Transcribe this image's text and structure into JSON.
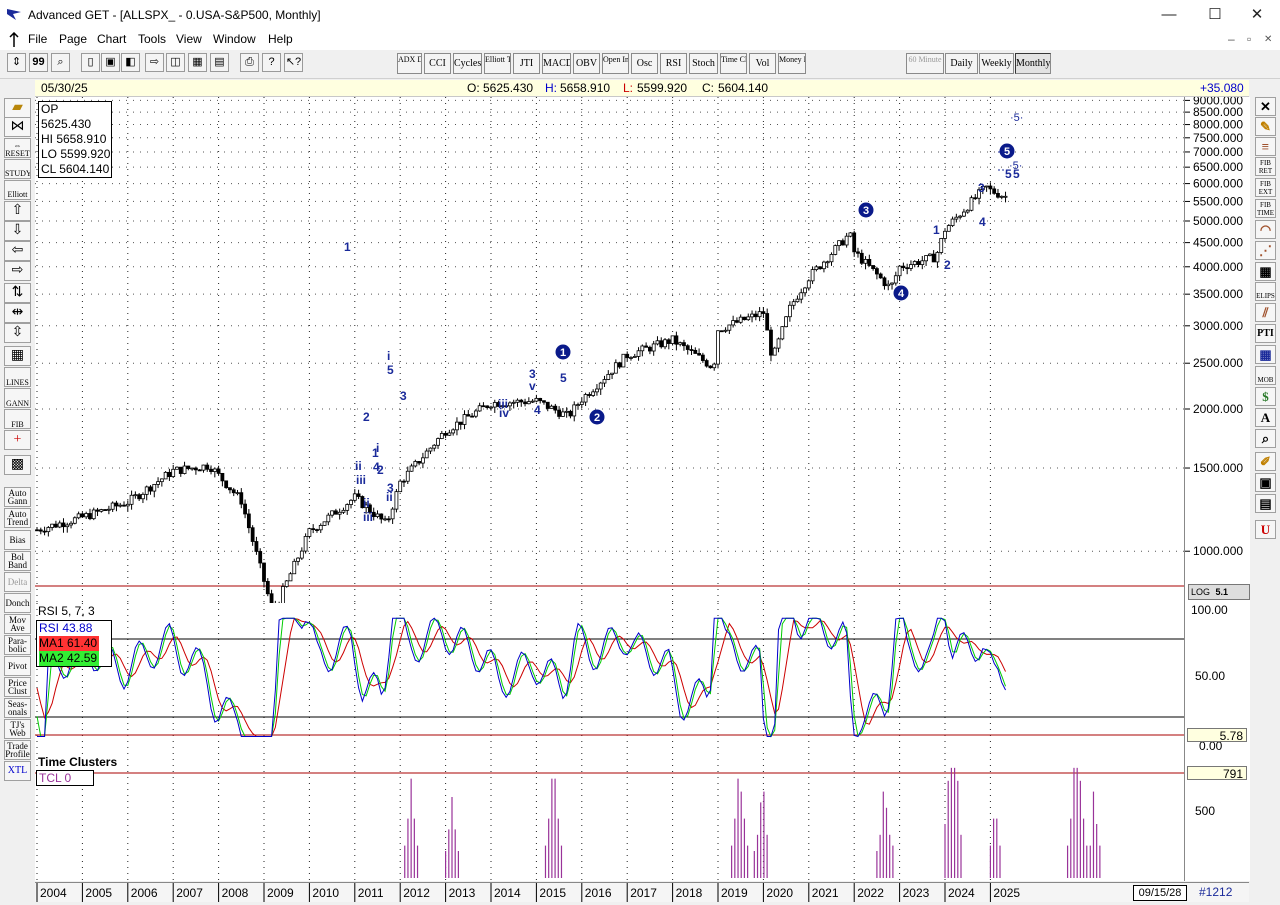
{
  "window": {
    "title": "Advanced GET - [ALLSPX_ - 0.USA-S&P500, Monthly]",
    "minimize": "—",
    "maximize": "☐",
    "close": "✕"
  },
  "menu": [
    "File",
    "Page",
    "Chart",
    "Tools",
    "View",
    "Window",
    "Help"
  ],
  "mdi": {
    "minimize": "–",
    "restore": "▫",
    "close": "✕"
  },
  "toolbar": {
    "indicators": [
      "ADX DMI",
      "CCI",
      "Cycles",
      "Elliott Trig",
      "JTI",
      "MACD",
      "OBV",
      "Open Int",
      "Osc",
      "RSI",
      "Stoch",
      "Time Clust",
      "Vol",
      "Money Flow"
    ],
    "timeframes": [
      "60 Minute",
      "Daily",
      "Weekly",
      "Monthly"
    ]
  },
  "infobar": {
    "date": "05/30/25",
    "open_label": "O:",
    "open": "5625.430",
    "high_label": "H:",
    "high": "5658.910",
    "low_label": "L:",
    "low": "5599.920",
    "close_label": "C:",
    "close": "5604.140",
    "change": "+35.080"
  },
  "ohlc_box": {
    "op": "OP 5625.430",
    "hi": "HI  5658.910",
    "lo": "LO 5599.920",
    "cl": "CL  5604.140"
  },
  "left_tools": [
    "RESET",
    "STUDY",
    "Elliott",
    "LINES",
    "GANN",
    "FIB",
    "Auto Gann",
    "Auto Trend",
    "Bias",
    "Bol Band",
    "Delta",
    "Donch",
    "Mov Ave",
    "Para-bolic",
    "Pivot",
    "Price Clust",
    "Seas-onals",
    "TJ's Web",
    "Trade Profile",
    "XTL"
  ],
  "right_tools": [
    "FIB RET",
    "FIB EXT",
    "FIB TIME",
    "ELIPS",
    "PTI",
    "MOB",
    "A"
  ],
  "price_scale": {
    "labels": [
      "9000.000",
      "8500.000",
      "8000.000",
      "7500.000",
      "7000.000",
      "6500.000",
      "6000.000",
      "5500.000",
      "5000.000",
      "4500.000",
      "4000.000",
      "3500.000",
      "3000.000",
      "2500.000",
      "2000.000",
      "1500.000",
      "1000.000"
    ],
    "log_label": "LOG",
    "log_value": "5.1"
  },
  "rsi": {
    "title": "RSI 5, 7, 3",
    "rsi": "RSI  43.88",
    "ma1": "MA1 61.40",
    "ma2": "MA2 42.59",
    "scale": [
      "100.00",
      "50.00",
      "0.00"
    ],
    "value_box": "5.78",
    "colors": {
      "rsi": "#0000cc",
      "ma1": "#cc0000",
      "ma2": "#00cc00"
    }
  },
  "time_clusters": {
    "title": "Time Clusters",
    "tcl": "TCL 0",
    "scale_label": "500",
    "value_box": "791",
    "color": "#993399"
  },
  "date_axis": {
    "years": [
      "2004",
      "2005",
      "2006",
      "2007",
      "2008",
      "2009",
      "2010",
      "2011",
      "2012",
      "2013",
      "2014",
      "2015",
      "2016",
      "2017",
      "2018",
      "2019",
      "2020",
      "2021",
      "2022",
      "2023",
      "2024",
      "2025"
    ],
    "future_date": "09/15/28",
    "bar_number": "#1212"
  },
  "chart_data": {
    "type": "candlestick",
    "title": "ALLSPX_ - 0.USA-S&P500, Monthly",
    "scale": "log",
    "ylim": [
      800,
      9000
    ],
    "x": [
      "2004",
      "2005",
      "2006",
      "2007",
      "2007.8",
      "2008.5",
      "2009.2",
      "2010",
      "2011",
      "2011.7",
      "2012",
      "2013",
      "2014",
      "2015",
      "2015.7",
      "2016",
      "2017",
      "2018",
      "2018.9",
      "2019",
      "2020",
      "2020.2",
      "2020.6",
      "2021",
      "2021.9",
      "2022",
      "2022.8",
      "2023",
      "2023.8",
      "2024",
      "2024.9",
      "2025",
      "2025.4"
    ],
    "close": [
      1110,
      1180,
      1270,
      1480,
      1520,
      1280,
      740,
      1100,
      1300,
      1140,
      1400,
      1800,
      2060,
      2080,
      1930,
      2100,
      2600,
      2800,
      2450,
      2950,
      3200,
      2550,
      3300,
      3800,
      4700,
      4300,
      3600,
      4000,
      4200,
      4800,
      5900,
      5800,
      5604
    ],
    "elliott_labels": [
      "1",
      "2",
      "3",
      "4",
      "5",
      "i",
      "ii",
      "iii",
      "iv",
      "v"
    ],
    "rsi_ylim": [
      0,
      100
    ],
    "time_cluster_ylim": [
      0,
      800
    ]
  }
}
